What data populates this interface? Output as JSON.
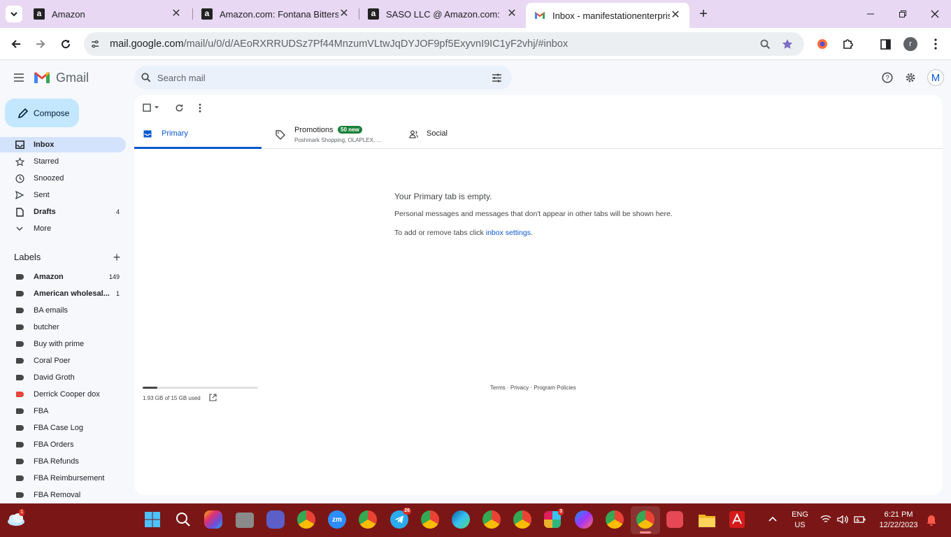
{
  "browser": {
    "tabs": [
      {
        "title": "Amazon",
        "icon": "amazon-icon"
      },
      {
        "title": "Amazon.com: Fontana Bittersw",
        "icon": "amazon-icon"
      },
      {
        "title": "SASO LLC @ Amazon.com:",
        "icon": "amazon-icon"
      },
      {
        "title": "Inbox - manifestationenterprise",
        "icon": "gmail-icon",
        "active": true
      }
    ],
    "url_host": "mail.google.com",
    "url_path": "/mail/u/0/d/AEoRXRRUDSz7Pf44MnzumVLtwJqDYJOF9pf5ExyvnI9IC1yF2vhj/#inbox",
    "profile_initial": "r"
  },
  "gmail": {
    "logo_text": "Gmail",
    "search_placeholder": "Search mail",
    "account_initial": "M",
    "compose_label": "Compose",
    "nav": [
      {
        "label": "Inbox",
        "count": "",
        "icon": "inbox-icon"
      },
      {
        "label": "Starred",
        "count": "",
        "icon": "star-icon"
      },
      {
        "label": "Snoozed",
        "count": "",
        "icon": "clock-icon"
      },
      {
        "label": "Sent",
        "count": "",
        "icon": "send-icon"
      },
      {
        "label": "Drafts",
        "count": "4",
        "icon": "draft-icon"
      },
      {
        "label": "More",
        "count": "",
        "icon": "chevron-down-icon"
      }
    ],
    "labels_heading": "Labels",
    "labels": [
      {
        "label": "Amazon",
        "count": "149",
        "bold": true,
        "color": "#444746"
      },
      {
        "label": "American wholesal...",
        "count": "1",
        "bold": true,
        "color": "#444746"
      },
      {
        "label": "BA emails",
        "count": "",
        "color": "#444746"
      },
      {
        "label": "butcher",
        "count": "",
        "color": "#444746"
      },
      {
        "label": "Buy with prime",
        "count": "",
        "color": "#444746"
      },
      {
        "label": "Coral Poer",
        "count": "",
        "color": "#444746"
      },
      {
        "label": "David Groth",
        "count": "",
        "color": "#444746"
      },
      {
        "label": "Derrick Cooper dox",
        "count": "",
        "color": "#e8453c"
      },
      {
        "label": "FBA",
        "count": "",
        "color": "#444746"
      },
      {
        "label": "FBA Case Log",
        "count": "",
        "color": "#444746"
      },
      {
        "label": "FBA Orders",
        "count": "",
        "color": "#444746"
      },
      {
        "label": "FBA Refunds",
        "count": "",
        "color": "#444746"
      },
      {
        "label": "FBA Reimbursement",
        "count": "",
        "color": "#444746"
      },
      {
        "label": "FBA Removal",
        "count": "",
        "color": "#444746"
      }
    ],
    "categories": {
      "primary": "Primary",
      "promotions": "Promotions",
      "promotions_badge": "50 new",
      "promotions_snippet": "Poshmark Shopping, OLAPLEX, ...",
      "social": "Social"
    },
    "empty": {
      "title": "Your Primary tab is empty.",
      "line1": "Personal messages and messages that don't appear in other tabs will be shown here.",
      "line2_prefix": "To add or remove tabs click ",
      "line2_link": "inbox settings",
      "line2_suffix": "."
    },
    "storage": {
      "text": "1.93 GB of 15 GB used",
      "used_fraction": 0.129
    },
    "footer_links": {
      "terms": "Terms",
      "sep": " · ",
      "privacy": "Privacy",
      "policies": "Program Policies"
    }
  },
  "taskbar": {
    "lang": "ENG",
    "region": "US",
    "time": "6:21 PM",
    "date": "12/22/2023",
    "badges": {
      "weather": "1",
      "telegram": "26",
      "slack": "3"
    }
  },
  "colors": {
    "accent": "#0b57d0",
    "selected_nav": "#d3e3fd",
    "compose": "#c2e7ff",
    "badge_green": "#188038",
    "taskbar": "#7a1716"
  }
}
